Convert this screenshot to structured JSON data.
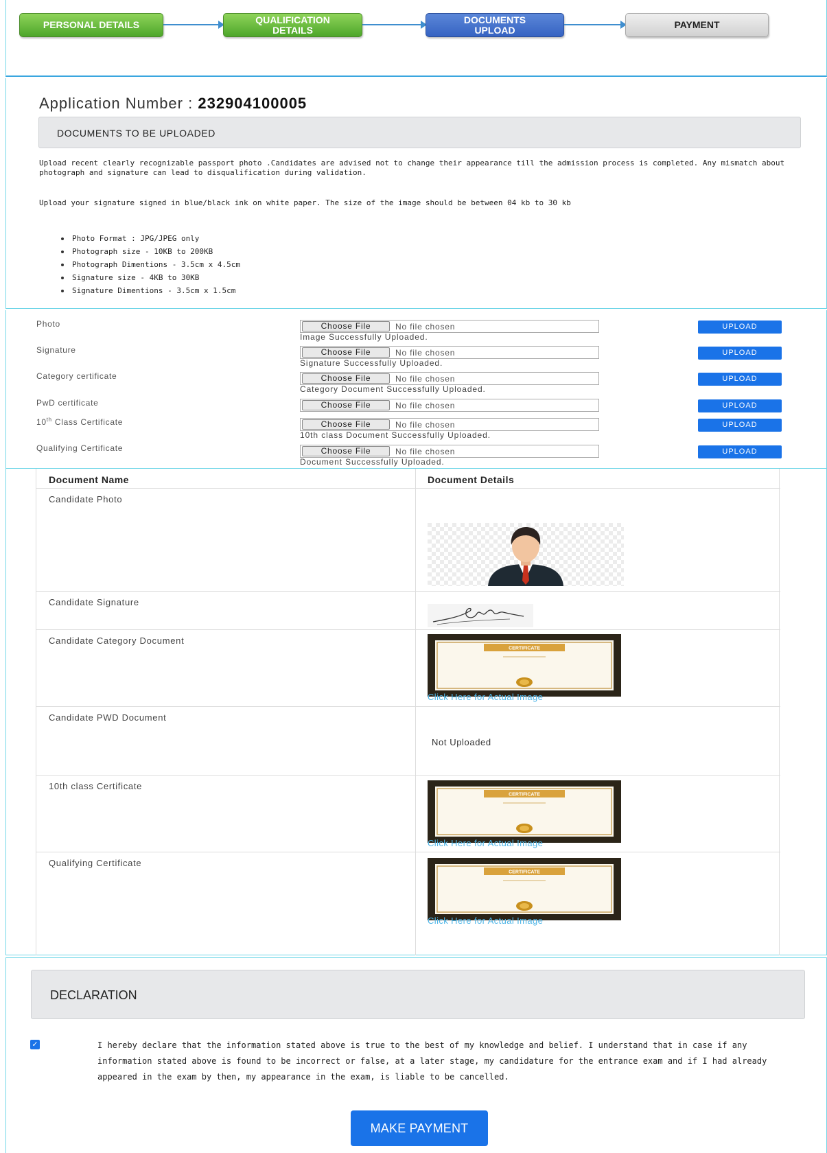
{
  "stepper": {
    "steps": [
      {
        "label": "PERSONAL DETAILS",
        "status": "completed"
      },
      {
        "label": "QUALIFICATION DETAILS",
        "status": "completed"
      },
      {
        "label": "DOCUMENTS UPLOAD",
        "status": "current"
      },
      {
        "label": "PAYMENT",
        "status": "pending"
      }
    ]
  },
  "application": {
    "label": "Application Number :",
    "number": "232904100005"
  },
  "documents_section": {
    "heading": "DOCUMENTS TO BE UPLOADED",
    "instructions": [
      "Upload recent clearly recognizable passport photo .Candidates are advised not to change their appearance till the admission process is completed. Any mismatch about photograph and signature can lead to disqualification during validation.",
      "Upload your signature signed in blue/black ink on white paper. The size of the image should be between 04 kb to 30 kb"
    ],
    "requirements": [
      "Photo Format : JPG/JPEG only",
      "Photograph size - 10KB to 200KB",
      "Photograph Dimentions - 3.5cm x 4.5cm",
      "Signature size - 4KB to 30KB",
      "Signature Dimentions - 3.5cm x 1.5cm"
    ]
  },
  "uploads": {
    "choose_label": "Choose File",
    "no_file": "No file chosen",
    "upload_label": "UPLOAD",
    "rows": [
      {
        "label": "Photo",
        "status": "Image Successfully Uploaded."
      },
      {
        "label": "Signature",
        "status": "Signature Successfully Uploaded."
      },
      {
        "label": "Category certificate",
        "status": "Category Document Successfully Uploaded."
      },
      {
        "label": "PwD certificate",
        "status": ""
      },
      {
        "label_pre": "10",
        "label_sup": "th",
        "label_post": " Class Certificate",
        "status": "10th class Document Successfully Uploaded."
      },
      {
        "label": "Qualifying Certificate",
        "status": "Document Successfully Uploaded."
      }
    ]
  },
  "doc_table": {
    "headers": {
      "name": "Document Name",
      "details": "Document Details"
    },
    "rows": [
      {
        "name": "Candidate Photo",
        "detail_type": "photo"
      },
      {
        "name": "Candidate Signature",
        "detail_type": "signature"
      },
      {
        "name": "Candidate Category Document",
        "detail_type": "certificate",
        "link": "Click Here for Actual Image"
      },
      {
        "name": "Candidate PWD Document",
        "detail_type": "text",
        "text": "Not Uploaded"
      },
      {
        "name": "10th class Certificate",
        "detail_type": "certificate",
        "link": "Click Here for Actual Image"
      },
      {
        "name": "Qualifying Certificate",
        "detail_type": "certificate",
        "link": "Click Here for Actual Image"
      }
    ],
    "certificate_badge": "CERTIFICATE"
  },
  "declaration": {
    "heading": "DECLARATION",
    "checked": true,
    "text_lines": [
      "I hereby declare that the information stated above is true to the best of my knowledge and belief. I understand that in case if any",
      "information stated above is found to be incorrect or false, at a later stage, my candidature for the entrance exam and if I had already",
      "appeared in the exam by then, my appearance in the exam, is liable to be cancelled."
    ],
    "button": "MAKE PAYMENT"
  },
  "colors": {
    "completed": "#4da62a",
    "current": "#3663c2",
    "pending": "#d1d1d1",
    "primary_button": "#1a73e8",
    "link": "#4fb6e8"
  }
}
